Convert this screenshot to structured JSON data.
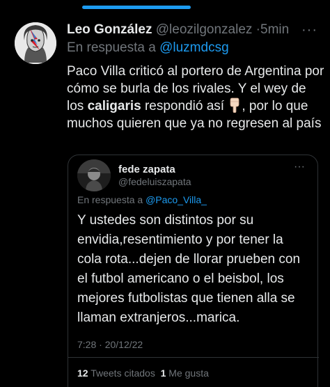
{
  "colors": {
    "background": "#000000",
    "text": "#e7e9ea",
    "muted": "#71767b",
    "accent": "#1d9bf0",
    "border": "#2f3336"
  },
  "tweet": {
    "author_name": "Leo González",
    "author_handle": "@leozilgonzalez",
    "separator": "·",
    "time_ago": "5min",
    "more_icon": "more-dots-icon",
    "reply_prefix": "En respuesta a",
    "reply_to": "@luzmdcsg",
    "text_part1": "Paco Villa criticó al portero de Argentina por cómo se burla de los rivales. Y el wey de los ",
    "text_bold": "caligaris",
    "text_part2": " respondió así ",
    "emoji": "pointing-down-hand-emoji",
    "text_part3": ", por lo que muchos quieren que ya no regresen al país"
  },
  "quoted_tweet": {
    "author_name": "fede zapata",
    "author_handle": "@fedeluiszapata",
    "reply_prefix": "En respuesta a",
    "reply_to": "@Paco_Villa_",
    "text": "Y ustedes son distintos por su envidia,resentimiento  y por tener la cola rota...dejen de llorar prueben con el futbol americano o el beisbol, los mejores futbolistas que tienen alla se llaman extranjeros...marica.",
    "timestamp": "7:28 · 20/12/22",
    "quote_count": "12",
    "quote_label": "Tweets citados",
    "like_count": "1",
    "like_label": "Me gusta"
  }
}
